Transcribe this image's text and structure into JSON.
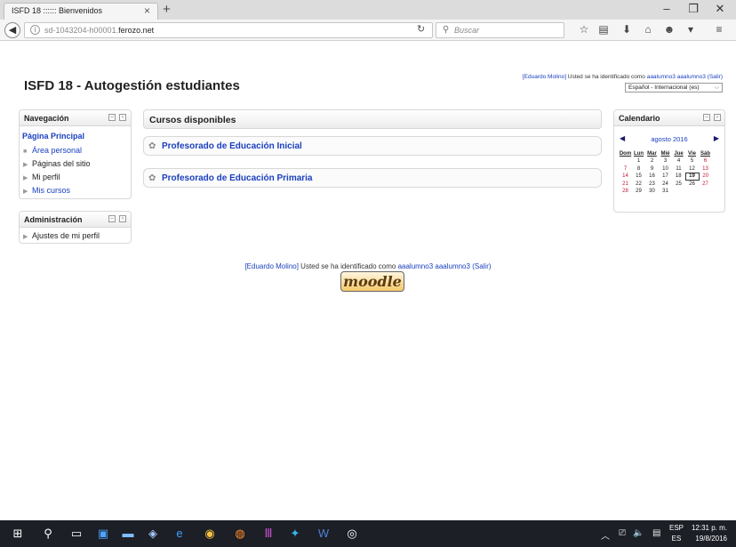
{
  "browser": {
    "tab_title": "ISFD 18 :::::: Bienvenidos",
    "url_prefix": "sd-1043204-h00001.",
    "url_domain": "ferozo.net",
    "search_placeholder": "Buscar"
  },
  "header": {
    "site_title": "ISFD 18 - Autogestión estudiantes",
    "user_name": "[Eduardo Molino]",
    "logged_text": " Usted se ha identificado como ",
    "login_as": "aaalumno3 aaalumno3",
    "logout": "(Salir)",
    "language": "Español - Internacional (es)"
  },
  "navigation": {
    "title": "Navegación",
    "home": "Página Principal",
    "items": [
      "Área personal",
      "Páginas del sitio",
      "Mi perfil",
      "Mis cursos"
    ]
  },
  "administration": {
    "title": "Administración",
    "items": [
      "Ajustes de mi perfil"
    ]
  },
  "main": {
    "title": "Cursos disponibles",
    "courses": [
      "Profesorado de Educación Inicial",
      "Profesorado de Educación Primaria"
    ]
  },
  "calendar": {
    "title": "Calendario",
    "month": "agosto 2016",
    "days": [
      "Dom",
      "Lun",
      "Mar",
      "Mié",
      "Jue",
      "Vie",
      "Sáb"
    ],
    "weeks": [
      [
        "",
        "1",
        "2",
        "3",
        "4",
        "5",
        "6"
      ],
      [
        "7",
        "8",
        "9",
        "10",
        "11",
        "12",
        "13"
      ],
      [
        "14",
        "15",
        "16",
        "17",
        "18",
        "19",
        "20"
      ],
      [
        "21",
        "22",
        "23",
        "24",
        "25",
        "26",
        "27"
      ],
      [
        "28",
        "29",
        "30",
        "31",
        "",
        "",
        ""
      ]
    ],
    "today": "19"
  },
  "footer": {
    "user_name": "[Eduardo Molino]",
    "logged_text": " Usted se ha identificado como ",
    "login_as": "aaalumno3 aaalumno3",
    "logout": "(Salir)",
    "logo_text": "moodle"
  },
  "taskbar": {
    "language_top": "ESP",
    "language_bottom": "ES",
    "time": "12:31 p. m.",
    "date": "19/8/2016"
  }
}
